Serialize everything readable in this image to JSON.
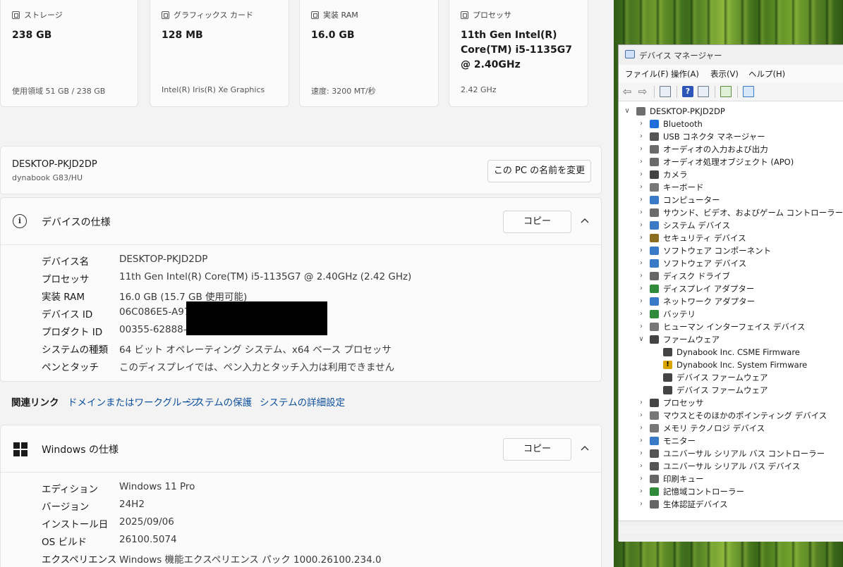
{
  "cards": [
    {
      "heading": "ストレージ",
      "value": "238 GB",
      "sub": "使用領域 51 GB / 238 GB"
    },
    {
      "heading": "グラフィックス カード",
      "value": "128 MB",
      "sub": "Intel(R) Iris(R) Xe Graphics"
    },
    {
      "heading": "実装 RAM",
      "value": "16.0 GB",
      "sub": "速度: 3200 MT/秒"
    },
    {
      "heading": "プロセッサ",
      "value": "11th Gen Intel(R) Core(TM) i5-1135G7 @ 2.40GHz",
      "sub": "2.42 GHz"
    }
  ],
  "pc": {
    "name": "DESKTOP-PKJD2DP",
    "model": "dynabook G83/HU",
    "rename_label": "この PC の名前を変更"
  },
  "device_spec": {
    "title": "デバイスの仕様",
    "copy_label": "コピー",
    "rows": [
      {
        "key": "デバイス名",
        "value": "DESKTOP-PKJD2DP"
      },
      {
        "key": "プロセッサ",
        "value": "11th Gen Intel(R) Core(TM) i5-1135G7 @ 2.40GHz (2.42 GHz)"
      },
      {
        "key": "実装 RAM",
        "value": "16.0 GB (15.7 GB 使用可能)"
      },
      {
        "key": "デバイス ID",
        "value": "06C086E5-A979"
      },
      {
        "key": "プロダクト ID",
        "value": "00355-62888-5"
      },
      {
        "key": "システムの種類",
        "value": "64 ビット オペレーティング システム、x64 ベース プロセッサ"
      },
      {
        "key": "ペンとタッチ",
        "value": "このディスプレイでは、ペン入力とタッチ入力は利用できません"
      }
    ]
  },
  "related": {
    "label": "関連リンク",
    "links": [
      "ドメインまたはワークグループ",
      "システムの保護",
      "システムの詳細設定"
    ]
  },
  "windows_spec": {
    "title": "Windows の仕様",
    "copy_label": "コピー",
    "rows": [
      {
        "key": "エディション",
        "value": "Windows 11 Pro"
      },
      {
        "key": "バージョン",
        "value": "24H2"
      },
      {
        "key": "インストール日",
        "value": "2025/09/06"
      },
      {
        "key": "OS ビルド",
        "value": "26100.5074"
      },
      {
        "key": "エクスペリエンス",
        "value": "Windows 機能エクスペリエンス パック 1000.26100.234.0"
      }
    ]
  },
  "device_manager": {
    "title": "デバイス マネージャー",
    "menus": [
      "ファイル(F)",
      "操作(A)",
      "表示(V)",
      "ヘルプ(H)"
    ],
    "root": "DESKTOP-PKJD2DP",
    "categories": [
      {
        "label": "Bluetooth",
        "icon": "bluetooth-icon",
        "color": "#1e6fd9"
      },
      {
        "label": "USB コネクタ マネージャー",
        "icon": "usb-icon",
        "color": "#555555"
      },
      {
        "label": "オーディオの入力および出力",
        "icon": "speaker-icon",
        "color": "#6b6b6b"
      },
      {
        "label": "オーディオ処理オブジェクト (APO)",
        "icon": "speaker-icon",
        "color": "#6b6b6b"
      },
      {
        "label": "カメラ",
        "icon": "camera-icon",
        "color": "#444444"
      },
      {
        "label": "キーボード",
        "icon": "keyboard-icon",
        "color": "#777777"
      },
      {
        "label": "コンピューター",
        "icon": "computer-icon",
        "color": "#3a7bc8"
      },
      {
        "label": "サウンド、ビデオ、およびゲーム コントローラー",
        "icon": "speaker-icon",
        "color": "#6b6b6b"
      },
      {
        "label": "システム デバイス",
        "icon": "system-device-icon",
        "color": "#3a7bc8"
      },
      {
        "label": "セキュリティ デバイス",
        "icon": "security-device-icon",
        "color": "#8a6d1e"
      },
      {
        "label": "ソフトウェア コンポーネント",
        "icon": "software-component-icon",
        "color": "#3a7bc8"
      },
      {
        "label": "ソフトウェア デバイス",
        "icon": "software-device-icon",
        "color": "#3a7bc8"
      },
      {
        "label": "ディスク ドライブ",
        "icon": "disk-drive-icon",
        "color": "#666666"
      },
      {
        "label": "ディスプレイ アダプター",
        "icon": "display-adapter-icon",
        "color": "#2f8a3a"
      },
      {
        "label": "ネットワーク アダプター",
        "icon": "network-adapter-icon",
        "color": "#3a7bc8"
      },
      {
        "label": "バッテリ",
        "icon": "battery-icon",
        "color": "#2f8a3a"
      },
      {
        "label": "ヒューマン インターフェイス デバイス",
        "icon": "hid-icon",
        "color": "#777777"
      },
      {
        "label": "ファームウェア",
        "icon": "firmware-icon",
        "color": "#444444",
        "expanded": true,
        "children": [
          {
            "label": "Dynabook Inc. CSME Firmware",
            "icon": "firmware-icon",
            "color": "#444444"
          },
          {
            "label": "Dynabook Inc. System Firmware",
            "icon": "warning-firmware-icon",
            "color": "#d9a400"
          },
          {
            "label": "デバイス ファームウェア",
            "icon": "firmware-icon",
            "color": "#444444"
          },
          {
            "label": "デバイス ファームウェア",
            "icon": "firmware-icon",
            "color": "#444444"
          }
        ]
      },
      {
        "label": "プロセッサ",
        "icon": "processor-icon",
        "color": "#444444"
      },
      {
        "label": "マウスとそのほかのポインティング デバイス",
        "icon": "mouse-icon",
        "color": "#777777"
      },
      {
        "label": "メモリ テクノロジ デバイス",
        "icon": "memory-icon",
        "color": "#777777"
      },
      {
        "label": "モニター",
        "icon": "monitor-icon",
        "color": "#3a7bc8"
      },
      {
        "label": "ユニバーサル シリアル バス コントローラー",
        "icon": "usb-icon",
        "color": "#555555"
      },
      {
        "label": "ユニバーサル シリアル バス デバイス",
        "icon": "usb-icon",
        "color": "#555555"
      },
      {
        "label": "印刷キュー",
        "icon": "printer-icon",
        "color": "#666666"
      },
      {
        "label": "記憶域コントローラー",
        "icon": "storage-controller-icon",
        "color": "#2f8a3a"
      },
      {
        "label": "生体認証デバイス",
        "icon": "fingerprint-icon",
        "color": "#666666"
      }
    ]
  }
}
